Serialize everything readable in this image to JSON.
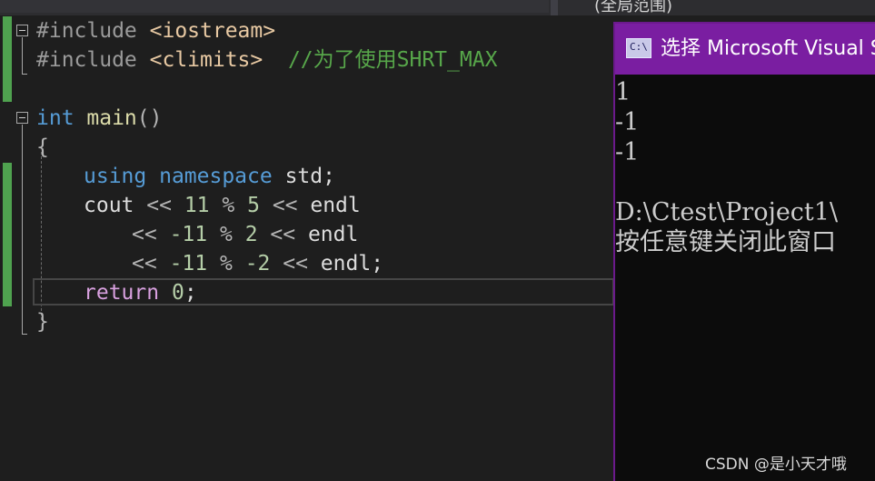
{
  "header": {
    "scope_text": "(全局范围)"
  },
  "editor": {
    "lines": {
      "l1": {
        "directive": "#include ",
        "header": "<iostream>"
      },
      "l2": {
        "directive": "#include ",
        "header": "<climits>",
        "comment": "  //为了使用SHRT_MAX"
      },
      "l3": {
        "type": "int",
        "func": " main",
        "paren": "()"
      },
      "l4": {
        "brace": "{"
      },
      "l5": {
        "kw1": "using",
        "kw2": " namespace",
        "rest": " std;"
      },
      "l6": {
        "a": "cout ",
        "op1": "<<",
        "sp1": " ",
        "n1": "11",
        "sp2": " ",
        "op2": "%",
        "sp3": " ",
        "n2": "5",
        "sp4": " ",
        "op3": "<<",
        "end": " endl"
      },
      "l7": {
        "op1": "<<",
        "sp1": " ",
        "n1": "-11",
        "sp2": " ",
        "op2": "%",
        "sp3": " ",
        "n2": "2",
        "sp4": " ",
        "op3": "<<",
        "end": " endl"
      },
      "l8": {
        "op1": "<<",
        "sp1": " ",
        "n1": "-11",
        "sp2": " ",
        "op2": "%",
        "sp3": " ",
        "n2": "-2",
        "sp4": " ",
        "op3": "<<",
        "end": " endl;"
      },
      "l9": {
        "kw": "return",
        "sp": " ",
        "num": "0",
        "end": ";"
      },
      "l10": {
        "brace": "}"
      }
    }
  },
  "console": {
    "title": "选择 Microsoft Visual Studio 调试控制台",
    "icon_text": "C:\\",
    "output": [
      "1",
      "-1",
      "-1",
      "",
      "D:\\Ctest\\Project1\\",
      "按任意键关闭此窗口"
    ]
  },
  "watermark": "CSDN @是小天才哦",
  "colors": {
    "console_title": "#7a1ea1",
    "change_bar": "#4fa24f",
    "keyword": "#569cd6",
    "comment": "#57a64a"
  }
}
